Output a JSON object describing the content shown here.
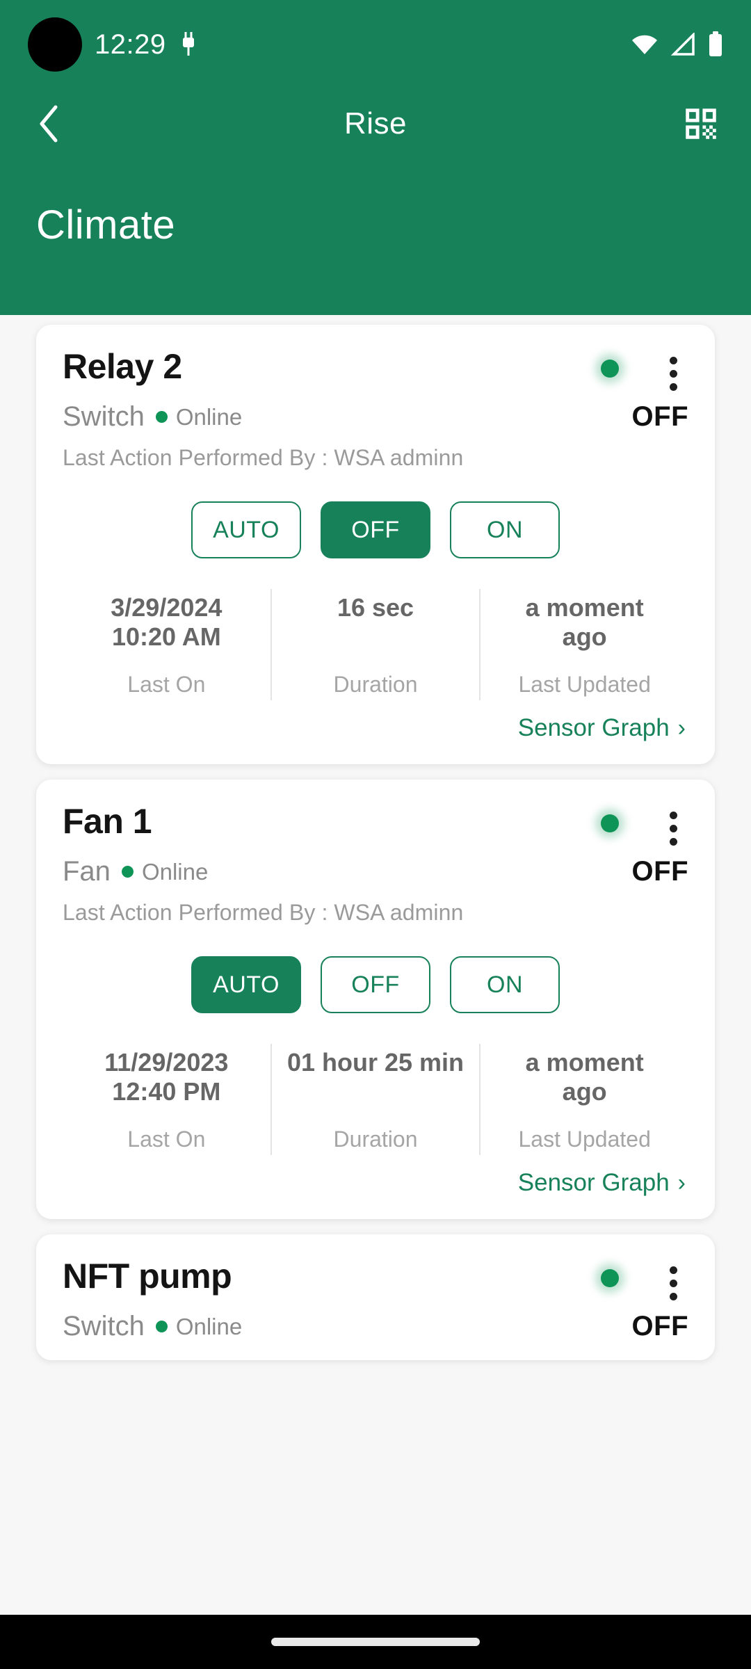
{
  "status_bar": {
    "time": "12:29",
    "icons": [
      "usb-debug-icon",
      "wifi-icon",
      "cellular-signal-icon",
      "battery-icon"
    ]
  },
  "app_bar": {
    "back_icon": "back-chevron-icon",
    "title": "Rise",
    "qr_icon": "qr-scan-icon"
  },
  "page": {
    "title": "Climate",
    "accent_color": "#17815A",
    "background_color": "#f7f7f7"
  },
  "devices": [
    {
      "name": "Relay 2",
      "type": "Switch",
      "connectivity": "Online",
      "state": "OFF",
      "last_action": "Last Action Performed By : WSA  adminn",
      "modes": [
        {
          "label": "AUTO",
          "active": false
        },
        {
          "label": "OFF",
          "active": true
        },
        {
          "label": "ON",
          "active": false
        }
      ],
      "stats": [
        {
          "value_line1": "3/29/2024",
          "value_line2": "10:20 AM",
          "label": "Last On"
        },
        {
          "value_line1": "16 sec",
          "value_line2": "",
          "label": "Duration"
        },
        {
          "value_line1": "a moment",
          "value_line2": "ago",
          "label": "Last Updated"
        }
      ],
      "sensor_link": "Sensor Graph"
    },
    {
      "name": "Fan 1",
      "type": "Fan",
      "connectivity": "Online",
      "state": "OFF",
      "last_action": "Last Action Performed By : WSA  adminn",
      "modes": [
        {
          "label": "AUTO",
          "active": true
        },
        {
          "label": "OFF",
          "active": false
        },
        {
          "label": "ON",
          "active": false
        }
      ],
      "stats": [
        {
          "value_line1": "11/29/2023",
          "value_line2": "12:40 PM",
          "label": "Last On"
        },
        {
          "value_line1": "01 hour 25 min",
          "value_line2": "",
          "label": "Duration"
        },
        {
          "value_line1": "a moment",
          "value_line2": "ago",
          "label": "Last Updated"
        }
      ],
      "sensor_link": "Sensor Graph"
    },
    {
      "name": "NFT pump",
      "type": "Switch",
      "connectivity": "Online",
      "state": "OFF",
      "last_action": "",
      "modes": [],
      "stats": [],
      "sensor_link": ""
    }
  ],
  "nav_bar": {
    "gesture_pill": "home-gesture-pill"
  }
}
